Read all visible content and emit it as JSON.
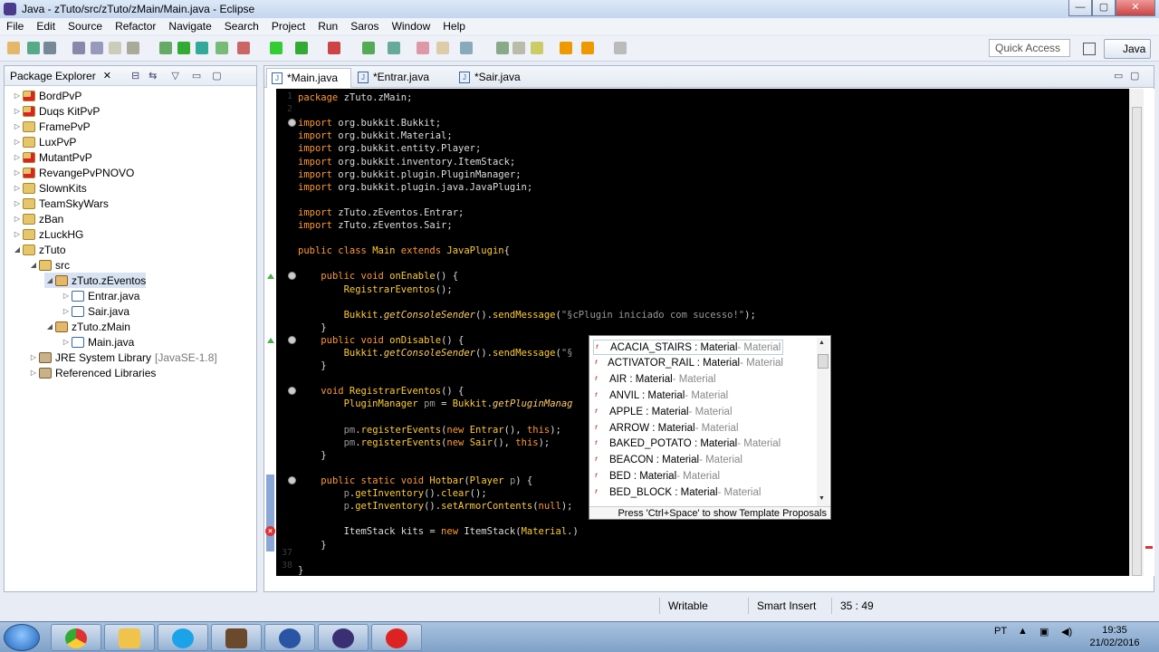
{
  "window": {
    "title": "Java - zTuto/src/zTuto/zMain/Main.java - Eclipse",
    "minimize": "—",
    "maximize": "▢",
    "close": "✕"
  },
  "menu": [
    "File",
    "Edit",
    "Source",
    "Refactor",
    "Navigate",
    "Search",
    "Project",
    "Run",
    "Saros",
    "Window",
    "Help"
  ],
  "quick_access": {
    "placeholder": "Quick Access"
  },
  "perspective": {
    "label": "Java"
  },
  "package_explorer": {
    "title": "Package Explorer",
    "items": [
      {
        "label": "BordPvP"
      },
      {
        "label": "Duqs KitPvP"
      },
      {
        "label": "FramePvP"
      },
      {
        "label": "LuxPvP"
      },
      {
        "label": "MutantPvP"
      },
      {
        "label": "RevangePvPNOVO"
      },
      {
        "label": "SlownKits"
      },
      {
        "label": "TeamSkyWars"
      },
      {
        "label": "zBan"
      },
      {
        "label": "zLuckHG"
      },
      {
        "label": "zTuto"
      },
      {
        "label": "src"
      },
      {
        "label": "zTuto.zEventos"
      },
      {
        "label": "Entrar.java"
      },
      {
        "label": "Sair.java"
      },
      {
        "label": "zTuto.zMain"
      },
      {
        "label": "Main.java"
      },
      {
        "label": "JRE System Library",
        "suffix": "[JavaSE-1.8]"
      },
      {
        "label": "Referenced Libraries"
      }
    ]
  },
  "editor": {
    "tabs": [
      {
        "label": "*Main.java",
        "active": true
      },
      {
        "label": "*Entrar.java",
        "active": false
      },
      {
        "label": "*Sair.java",
        "active": false
      }
    ],
    "line_numbers": {
      "first": "1",
      "second": "2",
      "before_last": "37",
      "last": "38"
    },
    "lines": [
      {
        "parts": [
          [
            "kw",
            "package"
          ],
          [
            "plain",
            " zTuto.zMain;"
          ]
        ]
      },
      {
        "parts": []
      },
      {
        "parts": [
          [
            "kw",
            "import"
          ],
          [
            "plain",
            " org.bukkit.Bukkit;"
          ]
        ]
      },
      {
        "parts": [
          [
            "kw",
            "import"
          ],
          [
            "plain",
            " org.bukkit.Material;"
          ]
        ]
      },
      {
        "parts": [
          [
            "kw",
            "import"
          ],
          [
            "plain",
            " org.bukkit.entity.Player;"
          ]
        ]
      },
      {
        "parts": [
          [
            "kw",
            "import"
          ],
          [
            "plain",
            " org.bukkit.inventory.ItemStack;"
          ]
        ]
      },
      {
        "parts": [
          [
            "kw",
            "import"
          ],
          [
            "plain",
            " org.bukkit.plugin.PluginManager;"
          ]
        ]
      },
      {
        "parts": [
          [
            "kw",
            "import"
          ],
          [
            "plain",
            " org.bukkit.plugin.java.JavaPlugin;"
          ]
        ]
      },
      {
        "parts": []
      },
      {
        "parts": [
          [
            "kw",
            "import"
          ],
          [
            "plain",
            " zTuto.zEventos.Entrar;"
          ]
        ]
      },
      {
        "parts": [
          [
            "kw",
            "import"
          ],
          [
            "plain",
            " zTuto.zEventos.Sair;"
          ]
        ]
      },
      {
        "parts": []
      },
      {
        "parts": [
          [
            "kw",
            "public class "
          ],
          [
            "ty",
            "Main "
          ],
          [
            "kw",
            "extends "
          ],
          [
            "ty",
            "JavaPlugin"
          ],
          [
            "plain",
            "{"
          ]
        ]
      },
      {
        "parts": []
      },
      {
        "parts": [
          [
            "plain",
            "    "
          ],
          [
            "kw",
            "public void "
          ],
          [
            "mth",
            "onEnable"
          ],
          [
            "plain",
            "() {"
          ]
        ]
      },
      {
        "parts": [
          [
            "plain",
            "        "
          ],
          [
            "mth",
            "RegistrarEventos"
          ],
          [
            "plain",
            "();"
          ]
        ]
      },
      {
        "parts": []
      },
      {
        "parts": [
          [
            "plain",
            "        "
          ],
          [
            "ty",
            "Bukkit"
          ],
          [
            "plain",
            "."
          ],
          [
            "fn",
            "getConsoleSender"
          ],
          [
            "plain",
            "()."
          ],
          [
            "mth",
            "sendMessage"
          ],
          [
            "plain",
            "("
          ],
          [
            "str",
            "\"§cPlugin iniciado com sucesso!\""
          ],
          [
            "plain",
            ");"
          ]
        ]
      },
      {
        "parts": [
          [
            "plain",
            "    }"
          ]
        ]
      },
      {
        "parts": [
          [
            "plain",
            "    "
          ],
          [
            "kw",
            "public void "
          ],
          [
            "mth",
            "onDisable"
          ],
          [
            "plain",
            "() {"
          ]
        ]
      },
      {
        "parts": [
          [
            "plain",
            "        "
          ],
          [
            "ty",
            "Bukkit"
          ],
          [
            "plain",
            "."
          ],
          [
            "fn",
            "getConsoleSender"
          ],
          [
            "plain",
            "()."
          ],
          [
            "mth",
            "sendMessage"
          ],
          [
            "plain",
            "("
          ],
          [
            "str",
            "\"§"
          ]
        ]
      },
      {
        "parts": [
          [
            "plain",
            "    }"
          ]
        ]
      },
      {
        "parts": []
      },
      {
        "parts": [
          [
            "plain",
            "    "
          ],
          [
            "kw",
            "void "
          ],
          [
            "mth",
            "RegistrarEventos"
          ],
          [
            "plain",
            "() {"
          ]
        ]
      },
      {
        "parts": [
          [
            "plain",
            "        "
          ],
          [
            "ty",
            "PluginManager "
          ],
          [
            "var",
            "pm"
          ],
          [
            "plain",
            " = "
          ],
          [
            "ty",
            "Bukkit"
          ],
          [
            "plain",
            "."
          ],
          [
            "fn",
            "getPluginManag"
          ]
        ]
      },
      {
        "parts": []
      },
      {
        "parts": [
          [
            "plain",
            "        "
          ],
          [
            "var",
            "pm"
          ],
          [
            "plain",
            "."
          ],
          [
            "mth",
            "registerEvents"
          ],
          [
            "plain",
            "("
          ],
          [
            "kw",
            "new "
          ],
          [
            "ty",
            "Entrar"
          ],
          [
            "plain",
            "(), "
          ],
          [
            "kw",
            "this"
          ],
          [
            "plain",
            ");"
          ]
        ]
      },
      {
        "parts": [
          [
            "plain",
            "        "
          ],
          [
            "var",
            "pm"
          ],
          [
            "plain",
            "."
          ],
          [
            "mth",
            "registerEvents"
          ],
          [
            "plain",
            "("
          ],
          [
            "kw",
            "new "
          ],
          [
            "ty",
            "Sair"
          ],
          [
            "plain",
            "(), "
          ],
          [
            "kw",
            "this"
          ],
          [
            "plain",
            ");"
          ]
        ]
      },
      {
        "parts": [
          [
            "plain",
            "    }"
          ]
        ]
      },
      {
        "parts": []
      },
      {
        "parts": [
          [
            "plain",
            "    "
          ],
          [
            "kw",
            "public static void "
          ],
          [
            "mth",
            "Hotbar"
          ],
          [
            "plain",
            "("
          ],
          [
            "ty",
            "Player "
          ],
          [
            "var",
            "p"
          ],
          [
            "plain",
            ") {"
          ]
        ]
      },
      {
        "parts": [
          [
            "plain",
            "        "
          ],
          [
            "var",
            "p"
          ],
          [
            "plain",
            "."
          ],
          [
            "mth",
            "getInventory"
          ],
          [
            "plain",
            "()."
          ],
          [
            "mth",
            "clear"
          ],
          [
            "plain",
            "();"
          ]
        ]
      },
      {
        "parts": [
          [
            "plain",
            "        "
          ],
          [
            "var",
            "p"
          ],
          [
            "plain",
            "."
          ],
          [
            "mth",
            "getInventory"
          ],
          [
            "plain",
            "()."
          ],
          [
            "mth",
            "setArmorContents"
          ],
          [
            "plain",
            "("
          ],
          [
            "kw",
            "null"
          ],
          [
            "plain",
            ");"
          ]
        ]
      },
      {
        "parts": []
      },
      {
        "parts": [
          [
            "plain",
            "        ItemStack kits = "
          ],
          [
            "kw",
            "new "
          ],
          [
            "plain",
            "ItemStack("
          ],
          [
            "ty",
            "Material"
          ],
          [
            "plain",
            ".)"
          ]
        ]
      },
      {
        "parts": [
          [
            "plain",
            "    }"
          ]
        ]
      },
      {
        "parts": []
      },
      {
        "parts": [
          [
            "plain",
            "}"
          ]
        ]
      }
    ]
  },
  "autocomplete": {
    "items": [
      {
        "name": "ACACIA_STAIRS : Material",
        "type": " - Material"
      },
      {
        "name": "ACTIVATOR_RAIL : Material",
        "type": " - Material"
      },
      {
        "name": "AIR : Material",
        "type": " - Material"
      },
      {
        "name": "ANVIL : Material",
        "type": " - Material"
      },
      {
        "name": "APPLE : Material",
        "type": " - Material"
      },
      {
        "name": "ARROW : Material",
        "type": " - Material"
      },
      {
        "name": "BAKED_POTATO : Material",
        "type": " - Material"
      },
      {
        "name": "BEACON : Material",
        "type": " - Material"
      },
      {
        "name": "BED : Material",
        "type": " - Material"
      },
      {
        "name": "BED_BLOCK : Material",
        "type": " - Material"
      }
    ],
    "footer": "Press 'Ctrl+Space' to show Template Proposals"
  },
  "status": {
    "writable": "Writable",
    "insert": "Smart Insert",
    "position": "35 : 49"
  },
  "taskbar": {
    "lang": "PT",
    "time": "19:35",
    "date": "21/02/2016"
  }
}
